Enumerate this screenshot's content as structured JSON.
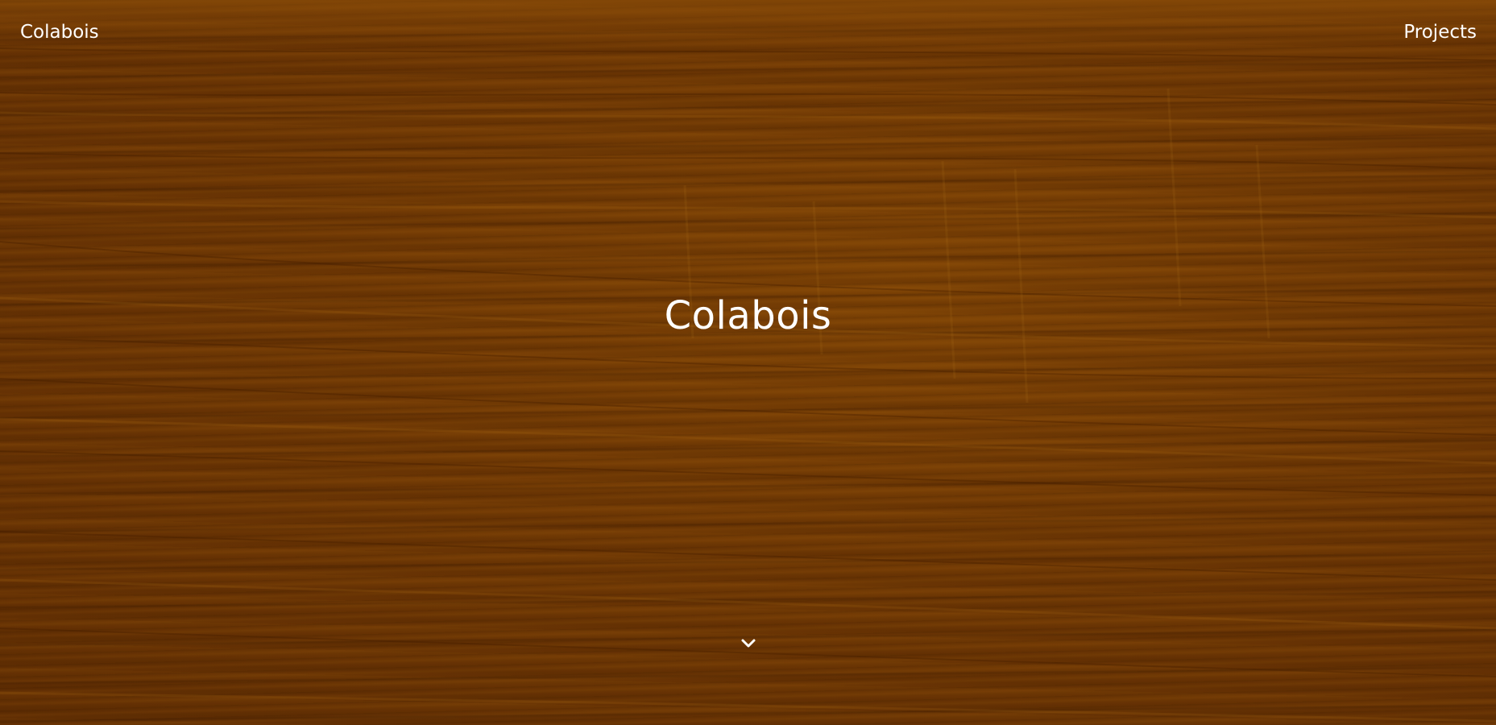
{
  "nav": {
    "brand": "Colabois",
    "links": [
      {
        "label": "Projects"
      }
    ]
  },
  "hero": {
    "title": "Colabois",
    "scroll_icon": "chevron-down-icon"
  },
  "colors": {
    "background_wood": "#7a3e05",
    "text": "#ffffff"
  }
}
